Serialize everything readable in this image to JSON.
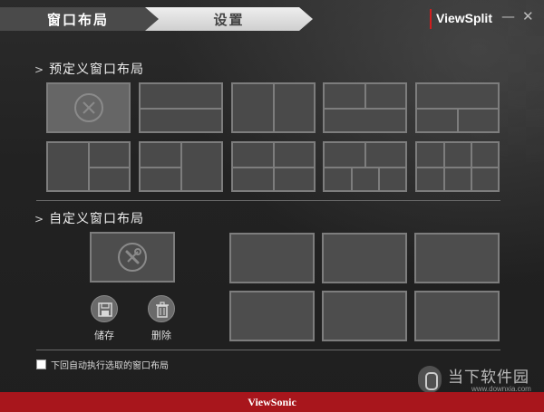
{
  "header": {
    "tab_layout": "窗口布局",
    "tab_settings": "设置",
    "brand": "ViewSplit",
    "minimize": "—",
    "close": "✕",
    "accent_color": "#d01e1e"
  },
  "predefined": {
    "title": "预定义窗口布局",
    "layouts": [
      {
        "id": "none",
        "icon": "x-circle-icon",
        "selected": true
      },
      {
        "id": "split-horizontal-2"
      },
      {
        "id": "split-vertical-2"
      },
      {
        "id": "left-full-right-split"
      },
      {
        "id": "left-split-right-full"
      },
      {
        "id": "left-full-right-split-b"
      },
      {
        "id": "left-split-right-full-b"
      },
      {
        "id": "top-split-bottom-split"
      },
      {
        "id": "top-full-bottom-three"
      },
      {
        "id": "grid-3x2"
      }
    ]
  },
  "custom": {
    "title": "自定义窗口布局",
    "edit_icon": "tools-icon",
    "save_label": "储存",
    "delete_label": "删除",
    "slots": 6
  },
  "options": {
    "auto_apply_label": "下回自动执行选取的窗口布局",
    "auto_apply_checked": false
  },
  "footer": {
    "brand": "ViewSonic"
  },
  "watermark": {
    "title": "当下软件园",
    "url": "www.downxia.com"
  }
}
